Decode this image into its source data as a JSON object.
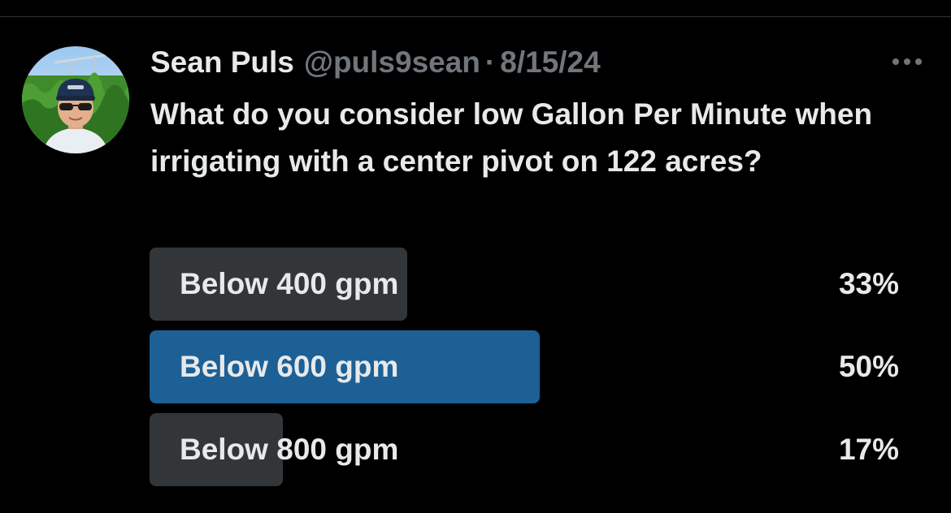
{
  "tweet": {
    "author_name": "Sean Puls",
    "handle": "@puls9sean",
    "separator": "·",
    "date": "8/15/24",
    "text": "What do you consider low Gallon Per Minute when irrigating with a center pivot on 122 acres?"
  },
  "poll": {
    "options": [
      {
        "label": "Below 400 gpm",
        "percent_text": "33%",
        "percent": 33,
        "winner": false
      },
      {
        "label": "Below 600 gpm",
        "percent_text": "50%",
        "percent": 50,
        "winner": true
      },
      {
        "label": "Below 800 gpm",
        "percent_text": "17%",
        "percent": 17,
        "winner": false
      }
    ]
  },
  "icons": {
    "more": "more-horizontal-icon",
    "avatar": "user-avatar"
  },
  "colors": {
    "background": "#000000",
    "text_primary": "#e7e9ea",
    "text_secondary": "#71767b",
    "poll_fill": "#333639",
    "poll_winner": "#1d6096"
  }
}
